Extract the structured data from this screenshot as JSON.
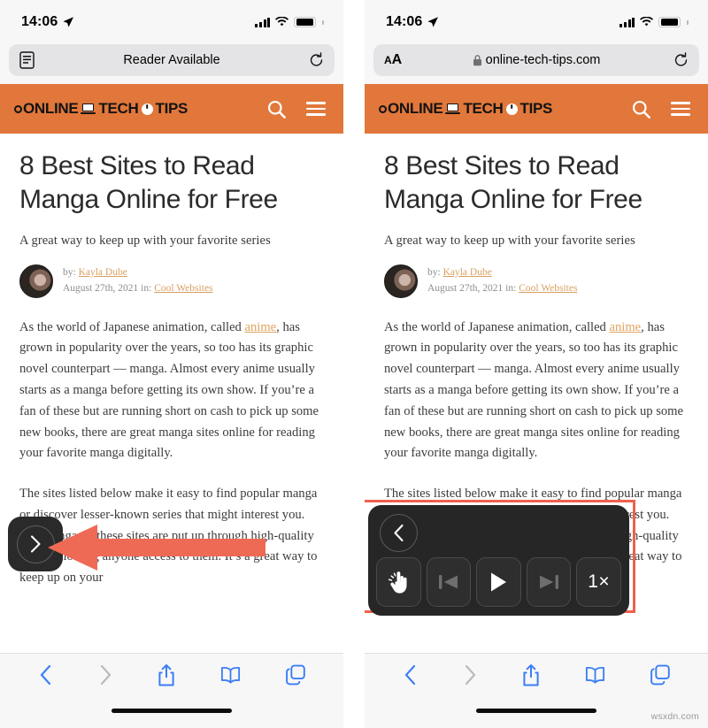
{
  "watermark": "wsxdn.com",
  "colors": {
    "site_header_orange": "#e1773a",
    "link_orange": "#e0a35e",
    "annotation_red": "#f0604d",
    "safari_blue": "#3b7df6",
    "overlay_dark": "#262626"
  },
  "panels": [
    {
      "id": "left",
      "status_bar": {
        "time": "14:06",
        "location_icon": "location-arrow-icon",
        "cellular_icon": "cellular-signal-icon",
        "wifi_icon": "wifi-icon",
        "battery_icon": "battery-full-icon"
      },
      "url_bar": {
        "left_icon": "reader-view-icon",
        "left_icon_label": "",
        "text": "Reader Available",
        "lock_visible": false,
        "reload_icon": "reload-icon"
      },
      "overlay": {
        "kind": "collapsed-speak-chip",
        "icon": "chevron-right-icon",
        "annotation": "red-left-arrow"
      }
    },
    {
      "id": "right",
      "status_bar": {
        "time": "14:06",
        "location_icon": "location-arrow-icon",
        "cellular_icon": "cellular-signal-icon",
        "wifi_icon": "wifi-icon",
        "battery_icon": "battery-full-icon"
      },
      "url_bar": {
        "left_icon": "text-size-icon",
        "left_icon_label": "AA",
        "text": "online-tech-tips.com",
        "lock_visible": true,
        "reload_icon": "reload-icon"
      },
      "overlay": {
        "kind": "expanded-speak-controller",
        "annotation": "red-rectangle",
        "back_icon": "chevron-left-icon",
        "buttons": [
          {
            "name": "speak-on-touch-button",
            "icon": "pointing-hand-icon",
            "label": ""
          },
          {
            "name": "previous-button",
            "icon": "skip-previous-icon",
            "label": ""
          },
          {
            "name": "play-button",
            "icon": "play-icon",
            "label": ""
          },
          {
            "name": "next-button",
            "icon": "skip-next-icon",
            "label": ""
          },
          {
            "name": "speed-button",
            "icon": "speed-icon",
            "label": "1×"
          }
        ]
      }
    }
  ],
  "site_header": {
    "logo_parts": [
      "ONLINE",
      "TECH",
      "TIPS"
    ],
    "logo_full": "ONLINE TECH TIPS",
    "search_icon": "search-icon",
    "menu_icon": "hamburger-menu-icon"
  },
  "article": {
    "title": "8 Best Sites to Read Manga Online for Free",
    "subtitle": "A great way to keep up with your favorite series",
    "byline": {
      "by_prefix": "by:",
      "author": "Kayla Dube",
      "date": "August 27th, 2021",
      "in_prefix": "in:",
      "category": "Cool Websites"
    },
    "paragraphs": [
      {
        "pre": "As the world of Japanese animation, called ",
        "link": "anime",
        "post": ", has grown in popularity over the years, so too has its graphic novel counterpart — manga. Almost every anime usually starts as a manga before getting its own show. If you’re a fan of these but are running short on cash to pick up some new books, there are great manga sites online for reading your favorite manga digitally."
      },
      {
        "pre": "The sites listed below make it easy to find popular manga or discover lesser-known series that might interest you. The manga on these sites are put up through high-quality scans, allowing anyone access to them. It’s a great way to keep up on your",
        "link": "",
        "post": ""
      }
    ]
  },
  "toolbar": {
    "items": [
      {
        "name": "back-button",
        "icon": "chevron-left-icon",
        "enabled": true
      },
      {
        "name": "forward-button",
        "icon": "chevron-right-icon",
        "enabled": false
      },
      {
        "name": "share-button",
        "icon": "share-icon",
        "enabled": true
      },
      {
        "name": "bookmarks-button",
        "icon": "book-icon",
        "enabled": true
      },
      {
        "name": "tabs-button",
        "icon": "tabs-icon",
        "enabled": true
      }
    ],
    "home_indicator": "home-indicator"
  }
}
